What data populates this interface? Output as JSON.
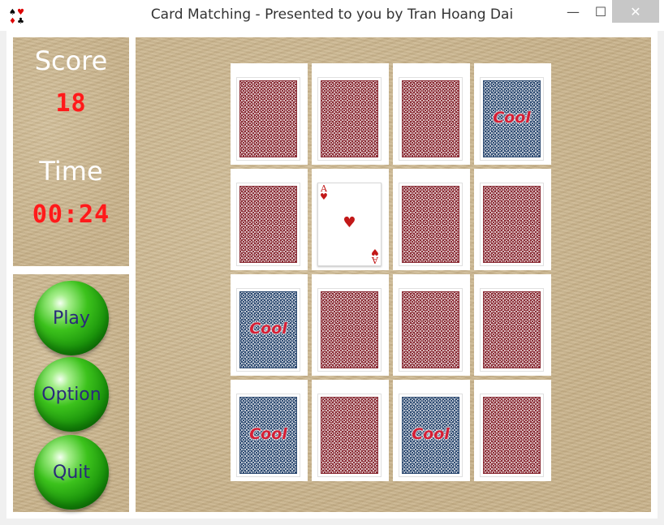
{
  "window": {
    "title": "Card Matching - Presented to you by Tran Hoang Dai",
    "minimize_glyph": "—",
    "maximize_glyph": "☐",
    "close_glyph": "✕"
  },
  "score_panel": {
    "score_label": "Score",
    "score_value": "18",
    "time_label": "Time",
    "time_value": "00:24"
  },
  "controls": {
    "play_label": "Play",
    "option_label": "Option",
    "quit_label": "Quit"
  },
  "cards": [
    {
      "state": "back",
      "back_color": "red"
    },
    {
      "state": "back",
      "back_color": "red"
    },
    {
      "state": "back",
      "back_color": "red"
    },
    {
      "state": "matched",
      "back_color": "blue",
      "text": "Cool"
    },
    {
      "state": "back",
      "back_color": "red"
    },
    {
      "state": "face",
      "rank": "A",
      "suit": "♥"
    },
    {
      "state": "back",
      "back_color": "red"
    },
    {
      "state": "back",
      "back_color": "red"
    },
    {
      "state": "matched",
      "back_color": "blue",
      "text": "Cool"
    },
    {
      "state": "back",
      "back_color": "red"
    },
    {
      "state": "back",
      "back_color": "red"
    },
    {
      "state": "back",
      "back_color": "red"
    },
    {
      "state": "matched",
      "back_color": "blue",
      "text": "Cool"
    },
    {
      "state": "back",
      "back_color": "red"
    },
    {
      "state": "matched",
      "back_color": "blue",
      "text": "Cool"
    },
    {
      "state": "back",
      "back_color": "red"
    }
  ],
  "colors": {
    "digit_red": "#ff1a1a",
    "card_back_red": "#8a2c35",
    "card_back_blue": "#2e4b72",
    "cool_text": "#d41f35",
    "button_green": "#3cc21c"
  }
}
